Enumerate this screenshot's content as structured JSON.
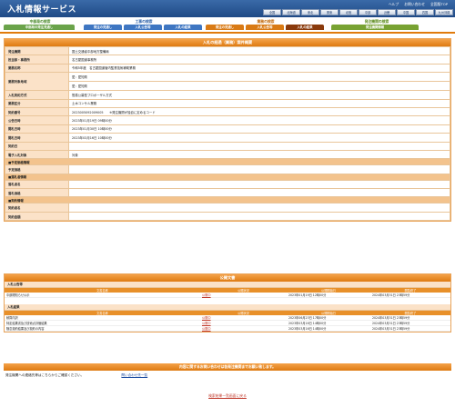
{
  "header": {
    "title": "入札情報サービス",
    "links": [
      "ヘルプ",
      "お問い合わせ",
      "全国版TOP"
    ],
    "regions": [
      "全国",
      "北海道",
      "東北",
      "関東",
      "北陸",
      "中部",
      "近畿",
      "中国",
      "四国",
      "九州沖縄"
    ]
  },
  "categories": [
    {
      "title": "中部局の検索",
      "tabs": [
        "中部局の発注見通し"
      ],
      "color": "#6aa34a"
    },
    {
      "title": "工事の検索",
      "tabs": [
        "発注の見通し",
        "入札公告等",
        "入札の結果"
      ],
      "color": "#3e76c2"
    },
    {
      "title": "業務の検索",
      "tabs": [
        "発注の見通し",
        "入札公告等",
        "入札の結果"
      ],
      "color": "#d97a14"
    },
    {
      "title": "発注機関の検索",
      "tabs": [
        "発注機関情報"
      ],
      "color": "#78a232"
    }
  ],
  "panel": {
    "title": "入札の経過（業務）案件概要",
    "rows": [
      {
        "label": "発注機関",
        "value": "国土交通省中部地方整備局"
      },
      {
        "label": "担当部・事務所",
        "value": "名古屋国道事務所"
      },
      {
        "label": "業務名称",
        "value": "令和5年度　名古屋国道管内監督技術補助業務"
      },
      {
        "label": "業務対象地域",
        "value": "愛：愛知県"
      },
      {
        "label": "",
        "value": "愛：愛知県"
      },
      {
        "label": "入札契約方式",
        "value": "簡易公募型プロポーザル方式"
      },
      {
        "label": "業務区分",
        "value": "土木コンサル業務"
      },
      {
        "label": "契約番号",
        "value": "2023005092009005　　※発注機関が独自に定めるコード"
      },
      {
        "label": "公告日時",
        "value": "2023年01月19日 09時00分"
      },
      {
        "label": "開札日時",
        "value": "2023年01月30日 10時00分"
      },
      {
        "label": "開札日時",
        "value": "2023年03月16日 10時00分"
      },
      {
        "label": "契約日",
        "value": ""
      },
      {
        "label": "電子入札対象",
        "value": "対象"
      }
    ],
    "sec1": "■予定価格情報",
    "sec1_rows": [
      {
        "label": "予定価格",
        "value": ""
      }
    ],
    "sec2": "■落札者情報",
    "sec2_rows": [
      {
        "label": "落札者名",
        "value": ""
      },
      {
        "label": "落札価格",
        "value": ""
      }
    ],
    "sec3": "■契約情報",
    "sec3_rows": [
      {
        "label": "契約者名",
        "value": ""
      },
      {
        "label": "契約金額",
        "value": ""
      }
    ]
  },
  "docs": {
    "title": "公開文書",
    "groups": [
      {
        "name": "入札公告等",
        "headers": [
          "文書名称",
          "公開状況",
          "公開開始日",
          "閲覧終了"
        ],
        "rows": [
          [
            "中部開知らせ公示",
            "公開中",
            "2023年01月19日 12時00分",
            "2024年03月31日 23時59分"
          ]
        ]
      },
      {
        "name": "入札結果",
        "headers": [
          "文書名称",
          "公開状況",
          "公開開始日",
          "閲覧終了"
        ],
        "rows": [
          [
            "積算内訳",
            "公開中",
            "2023年06月23日 17時00分",
            "2024年03月31日 23時59分"
          ],
          [
            "特定結果書及び技術点評価結果",
            "公開中",
            "2023年03月16日 14時00分",
            "2024年03月31日 23時59分"
          ],
          [
            "随意契約結果及び契約の内容",
            "公開中",
            "2023年03月16日 14時00分",
            "2024年03月31日 23時59分"
          ]
        ]
      }
    ]
  },
  "footer": {
    "bar": "内容に関するお問い合わせは各発注機関までお願い致します。",
    "contact": "発注機関への連絡先等はこちらからご確認ください。",
    "contact_link": "問い合わせ先一覧",
    "back": "検索結果一覧画面に戻る"
  }
}
